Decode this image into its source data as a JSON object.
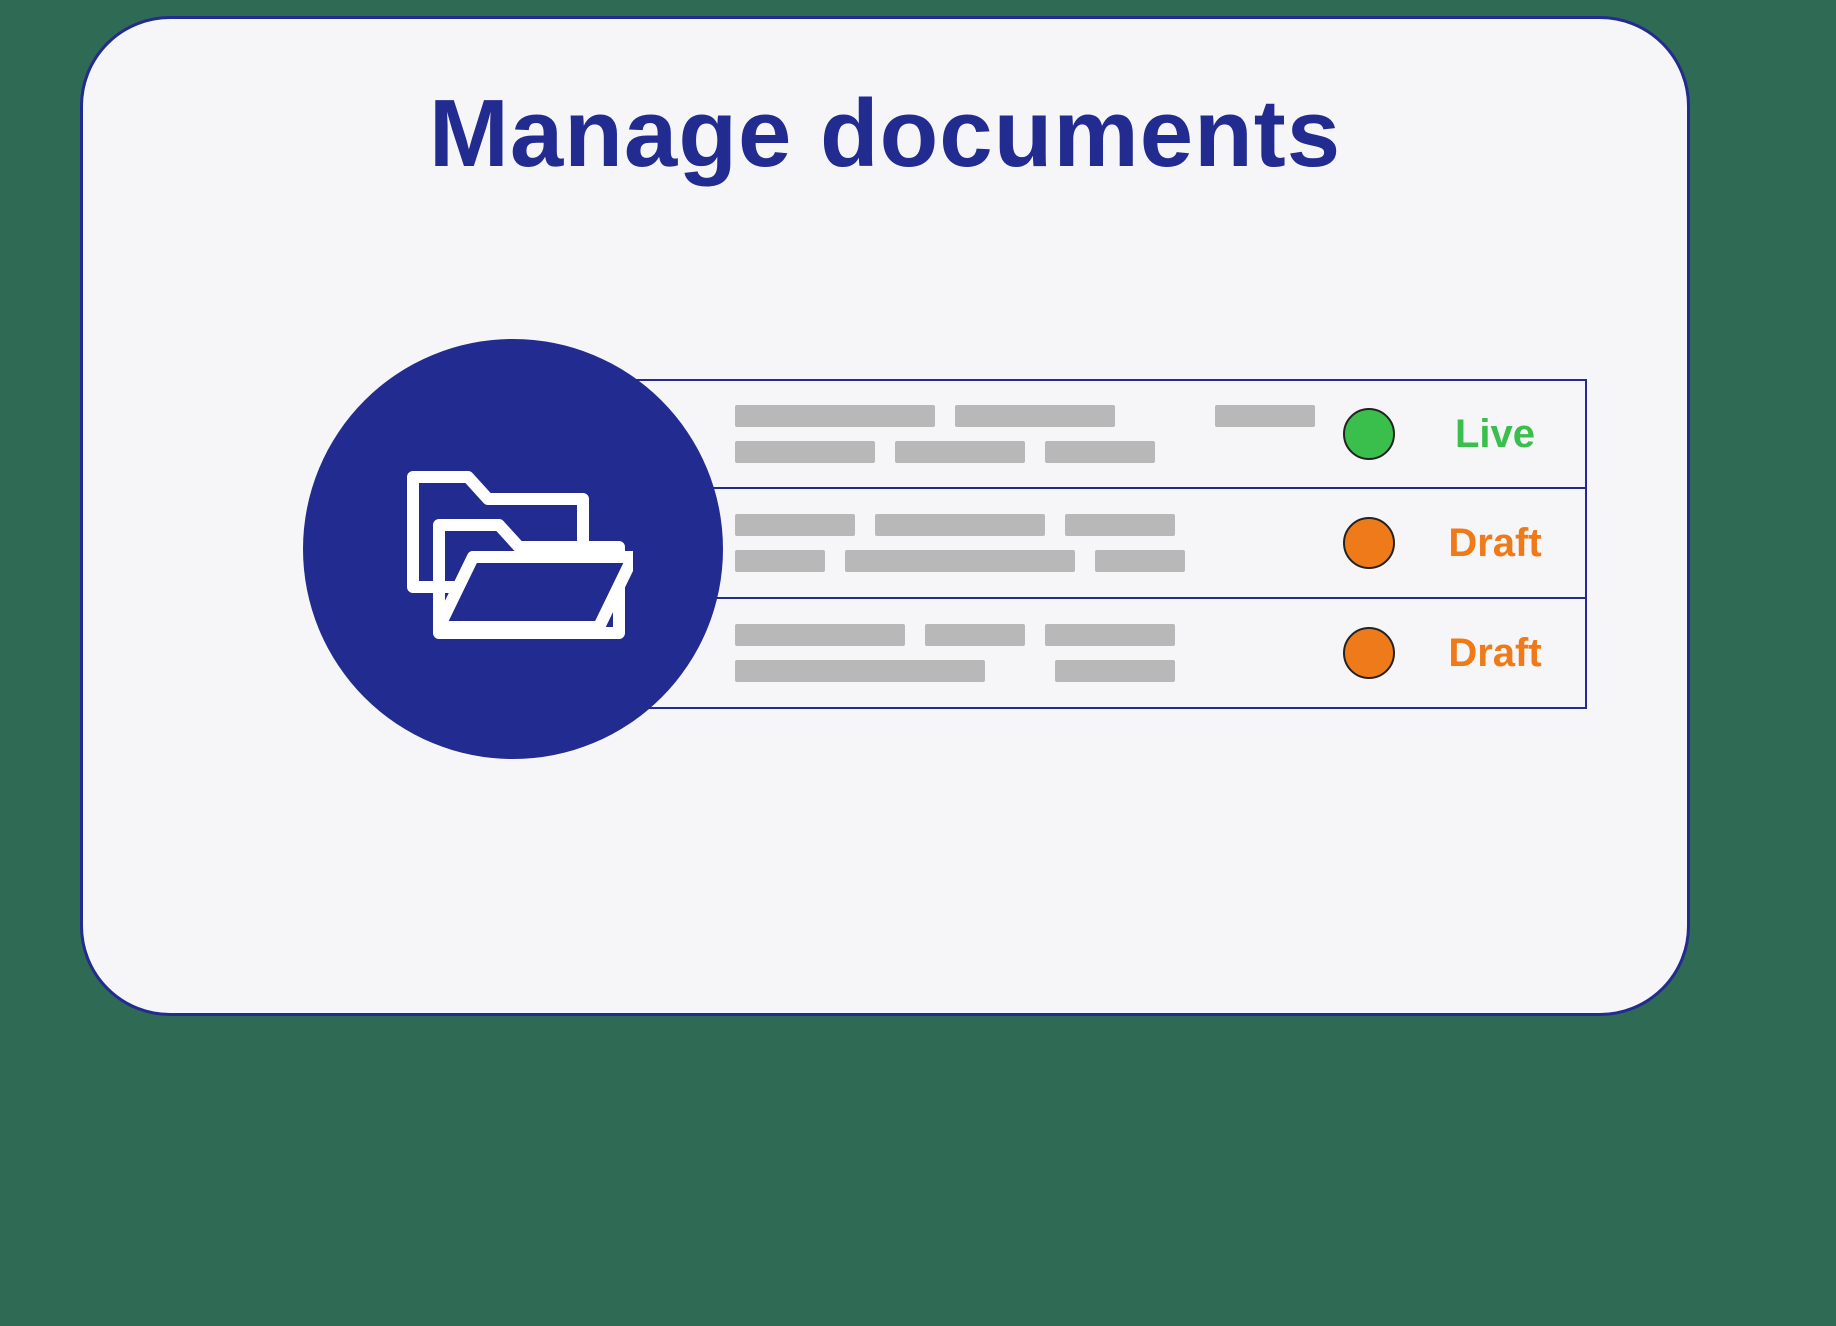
{
  "card": {
    "title": "Manage documents"
  },
  "documents": [
    {
      "status_label": "Live",
      "status_kind": "live"
    },
    {
      "status_label": "Draft",
      "status_kind": "draft"
    },
    {
      "status_label": "Draft",
      "status_kind": "draft"
    }
  ],
  "colors": {
    "brand": "#222b8f",
    "live": "#3bbf4c",
    "draft": "#ee7a1a",
    "placeholder": "#b8b8b8",
    "card_bg": "#f6f6f8",
    "page_bg": "#2f6a55"
  }
}
